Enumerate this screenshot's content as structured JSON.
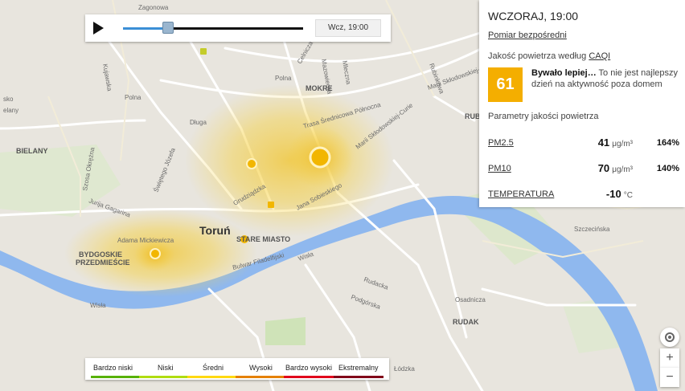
{
  "player": {
    "play_icon": "play-icon",
    "progress": 0.25,
    "time_label": "Wcz, 19:00"
  },
  "panel": {
    "title": "WCZORAJ, 19:00",
    "measure_link": "Pomiar bezpośredni",
    "caqi_prefix": "Jakość powietrza według ",
    "caqi_link": "CAQI",
    "index_value": "61",
    "index_color": "#f4ae00",
    "index_headline": "Bywało lepiej…",
    "index_text": " To nie jest najlepszy dzień na aktywność poza domem",
    "params_title": "Parametry jakości powietrza",
    "params": [
      {
        "name": "PM2.5",
        "value": "41",
        "unit": "μg/m³",
        "percent": "164%"
      },
      {
        "name": "PM10",
        "value": "70",
        "unit": "μg/m³",
        "percent": "140%"
      },
      {
        "name": "TEMPERATURA",
        "value": "-10",
        "unit": "°C",
        "percent": ""
      }
    ]
  },
  "controls": {
    "locate_icon": "crosshair-icon",
    "zoom_in": "+",
    "zoom_out": "−"
  },
  "legend": {
    "items": [
      {
        "label": "Bardzo niski",
        "color": "#57b108"
      },
      {
        "label": "Niski",
        "color": "#b0dd10"
      },
      {
        "label": "Średni",
        "color": "#ffd911"
      },
      {
        "label": "Wysoki",
        "color": "#e58100"
      },
      {
        "label": "Bardzo wysoki",
        "color": "#e0001b"
      },
      {
        "label": "Ekstremalny",
        "color": "#810019"
      }
    ]
  },
  "map": {
    "city": "Toruń",
    "labels": {
      "bielany_left": "Bielany",
      "bielany": "BIELANY",
      "mokre": "MOKRE",
      "stare_miasto": "STARE MIASTO",
      "bydgoskie": "BYDGOSKIE",
      "przedmiescie": "PRZEDMIEŚCIE",
      "rudak": "RUDAK",
      "wisla_1": "Wisła",
      "wisla_2": "Wisła",
      "polna": "Polna",
      "polna_2": "Polna",
      "dluga": "Długa",
      "bulwar": "Bulwar Filadelfijski",
      "szosa_okrezna": "Szosa Okrężna",
      "swietego_jozefa": "Świętego Józefa",
      "jurija_gagarina": "Jurija Gagarina",
      "adama_mickiewicza": "Adama Mickiewicza",
      "grudziadzka": "Grudziądzka",
      "jana_sobieskiego": "Jana Sobieskiego",
      "trasa": "Trasa Średnicowa Północna",
      "marii_sklodowskiej": "Marii Skłodowskiej-Curie",
      "szczecinska": "Szczecińska",
      "podgorska": "Podgórska",
      "rudacka": "Rudacka",
      "osadnicza": "Osadnicza",
      "lodzka": "Łódzka",
      "zagonowa": "Zagonowa",
      "celnicza": "Celnicza",
      "mazowiecka": "Mazowiecka",
      "mleczna": "Mleczna",
      "rubinkowa": "Rubinkowa",
      "ruc": "RUB",
      "elany": "elany",
      "sko": "sko",
      "kujawska": "Kujawska"
    }
  }
}
